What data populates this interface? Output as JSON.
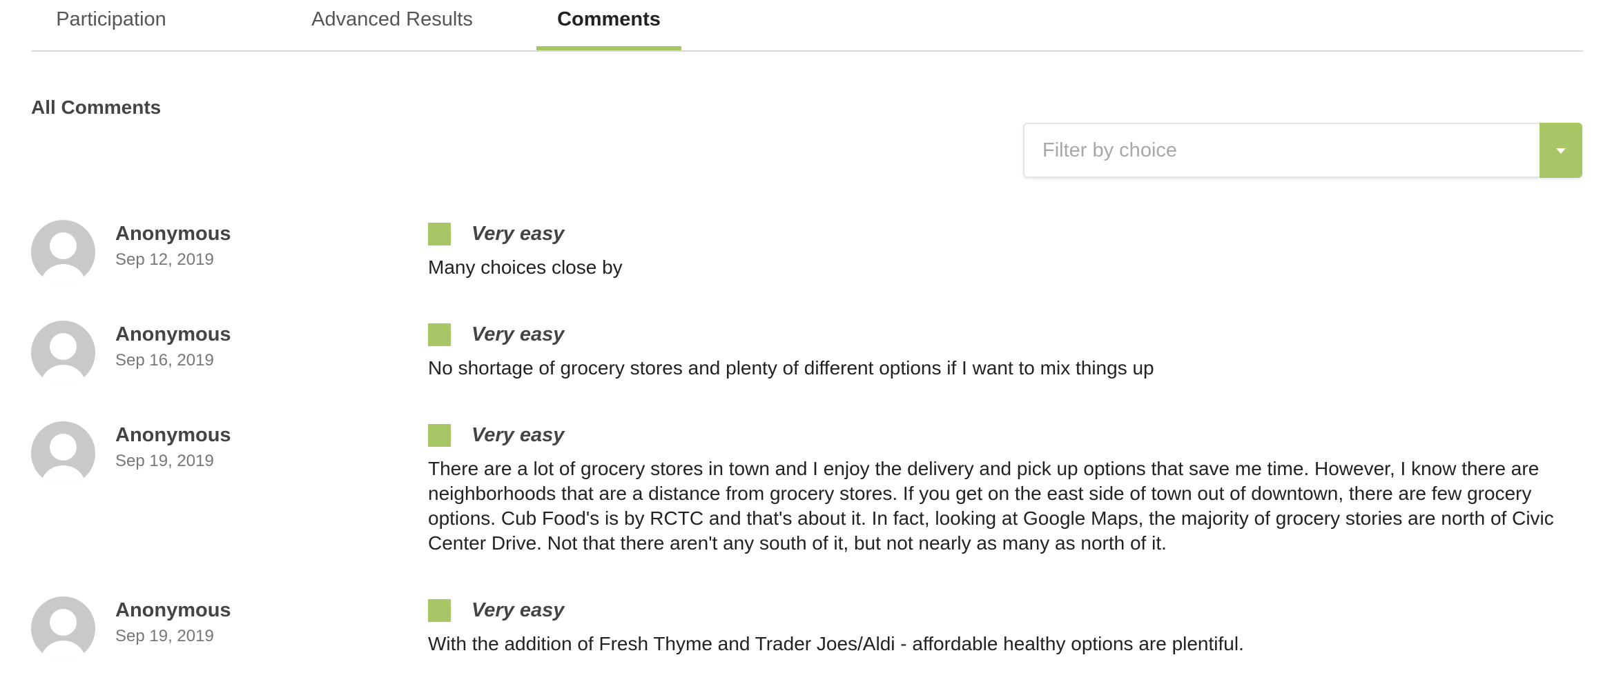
{
  "tabs": [
    {
      "label": "Participation",
      "active": false
    },
    {
      "label": "Advanced Results",
      "active": false
    },
    {
      "label": "Comments",
      "active": true
    }
  ],
  "section_title": "All Comments",
  "filter": {
    "placeholder": "Filter by choice",
    "value": ""
  },
  "colors": {
    "accent": "#a7c766",
    "tab_border": "#d9d9d9",
    "avatar": "#c9c9c9"
  },
  "icons": {
    "avatar": "user-avatar-icon",
    "dropdown": "chevron-down-icon",
    "choice_marker": "square-swatch"
  },
  "comments": [
    {
      "author": "Anonymous",
      "date": "Sep 12, 2019",
      "choice": "Very easy",
      "text": "Many choices close by"
    },
    {
      "author": "Anonymous",
      "date": "Sep 16, 2019",
      "choice": "Very easy",
      "text": "No shortage of grocery stores and plenty of different options if I want to mix things up"
    },
    {
      "author": "Anonymous",
      "date": "Sep 19, 2019",
      "choice": "Very easy",
      "text": "There are a lot of grocery stores in town and I enjoy the delivery and pick up options that save me time. However, I know there are neighborhoods that are a distance from grocery stores. If you get on the east side of town out of downtown, there are few grocery options. Cub Food's is by RCTC and that's about it. In fact, looking at Google Maps, the majority of grocery stories are north of Civic Center Drive. Not that there aren't any south of it, but not nearly as many as north of it."
    },
    {
      "author": "Anonymous",
      "date": "Sep 19, 2019",
      "choice": "Very easy",
      "text": "With the addition of Fresh Thyme and Trader Joes/Aldi - affordable healthy options are plentiful."
    }
  ]
}
